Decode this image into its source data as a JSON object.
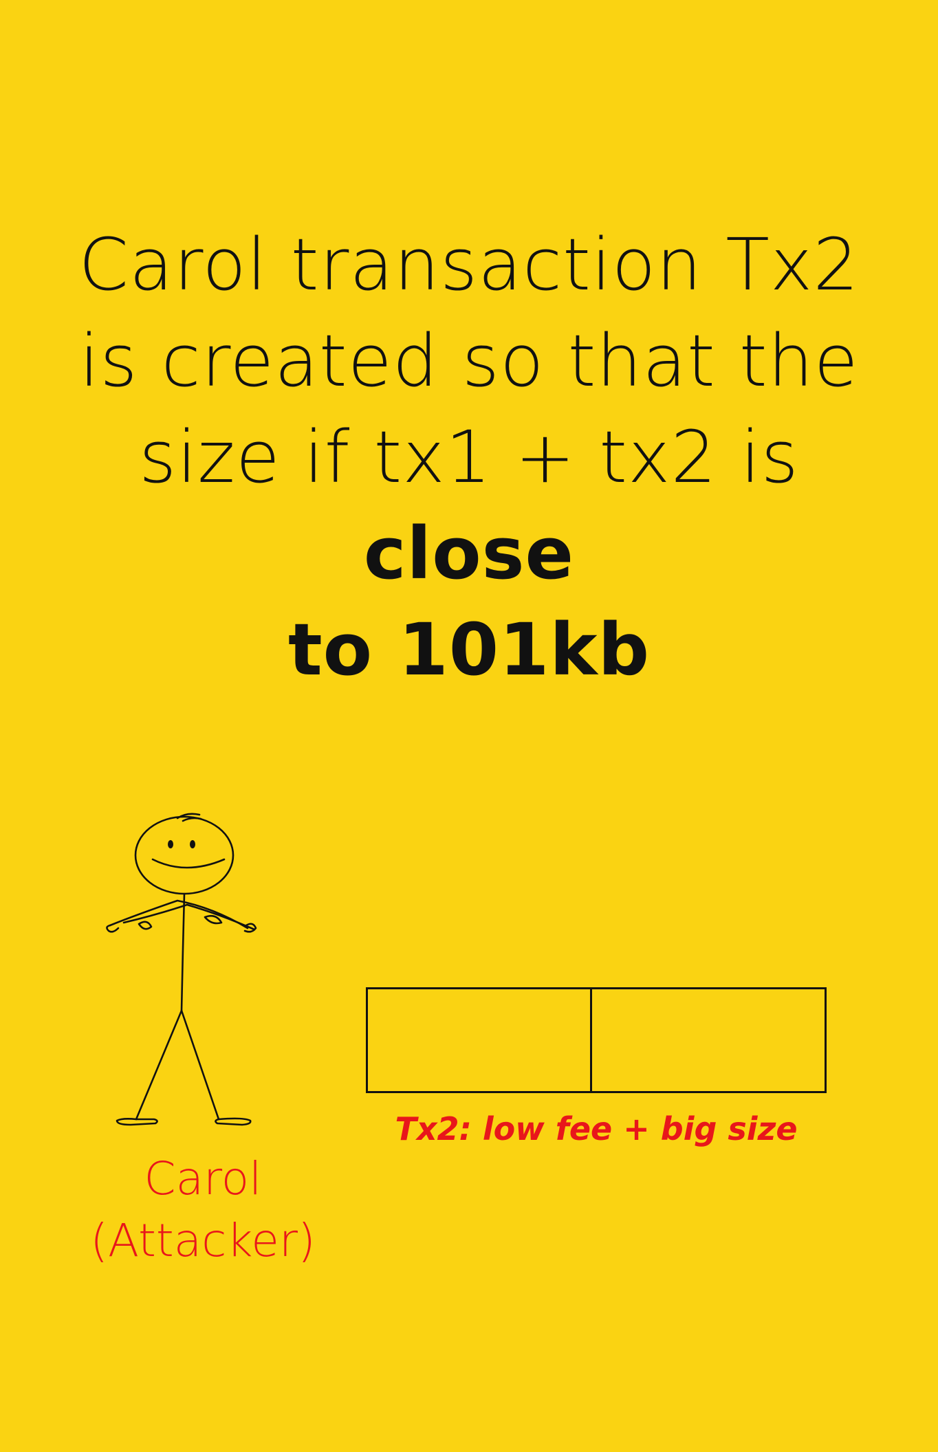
{
  "colors": {
    "background": "#FAD312",
    "text": "#111111",
    "accent": "#E8161B",
    "stroke": "#111111"
  },
  "headline": {
    "line1": "Carol transaction Tx2",
    "line2": "is created so that the",
    "line3_regular": "size if tx1 + tx2 is ",
    "line3_bold": "close",
    "line4_bold": "to 101kb"
  },
  "person": {
    "icon": "stick-figure-arms-crossed-icon",
    "name_line1": "Carol",
    "name_line2": "(Attacker)"
  },
  "transaction": {
    "segments": 2,
    "label": "Tx2: low fee + big size"
  }
}
